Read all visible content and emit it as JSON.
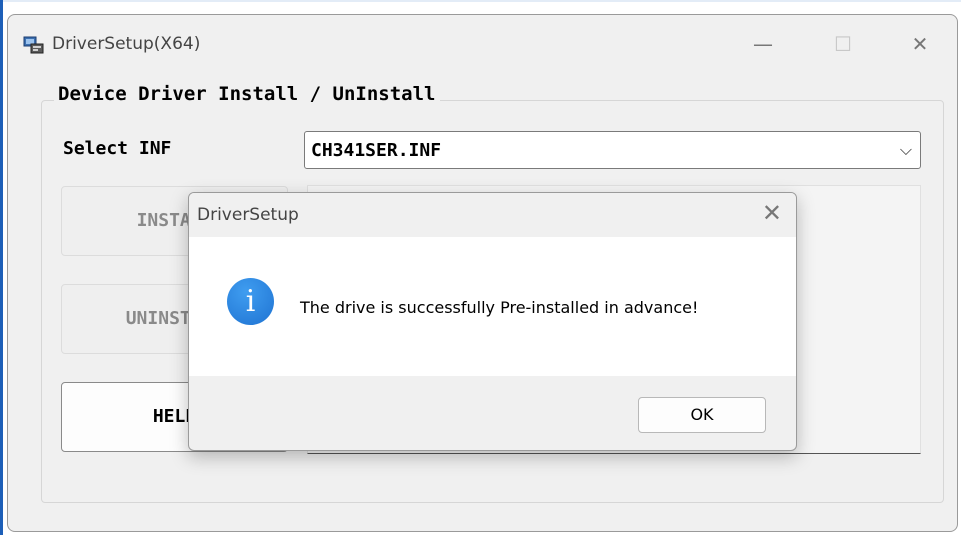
{
  "window": {
    "title": "DriverSetup(X64)",
    "minimize_glyph": "—",
    "maximize_glyph": "☐",
    "close_glyph": "✕"
  },
  "group": {
    "legend": "Device Driver Install / UnInstall"
  },
  "inf": {
    "label": "Select INF",
    "value": "CH341SER.INF",
    "chevron": "⌵"
  },
  "buttons": {
    "install": "INSTALL",
    "uninstall": "UNINSTALL",
    "help": "HELP"
  },
  "dialog": {
    "title": "DriverSetup",
    "close_glyph": "✕",
    "icon": "information-icon",
    "icon_glyph": "i",
    "message": "The drive is successfully Pre-installed in advance!",
    "ok_label": "OK"
  },
  "colors": {
    "window_bg": "#f0f0f0",
    "info_icon": "#1f73d2"
  }
}
